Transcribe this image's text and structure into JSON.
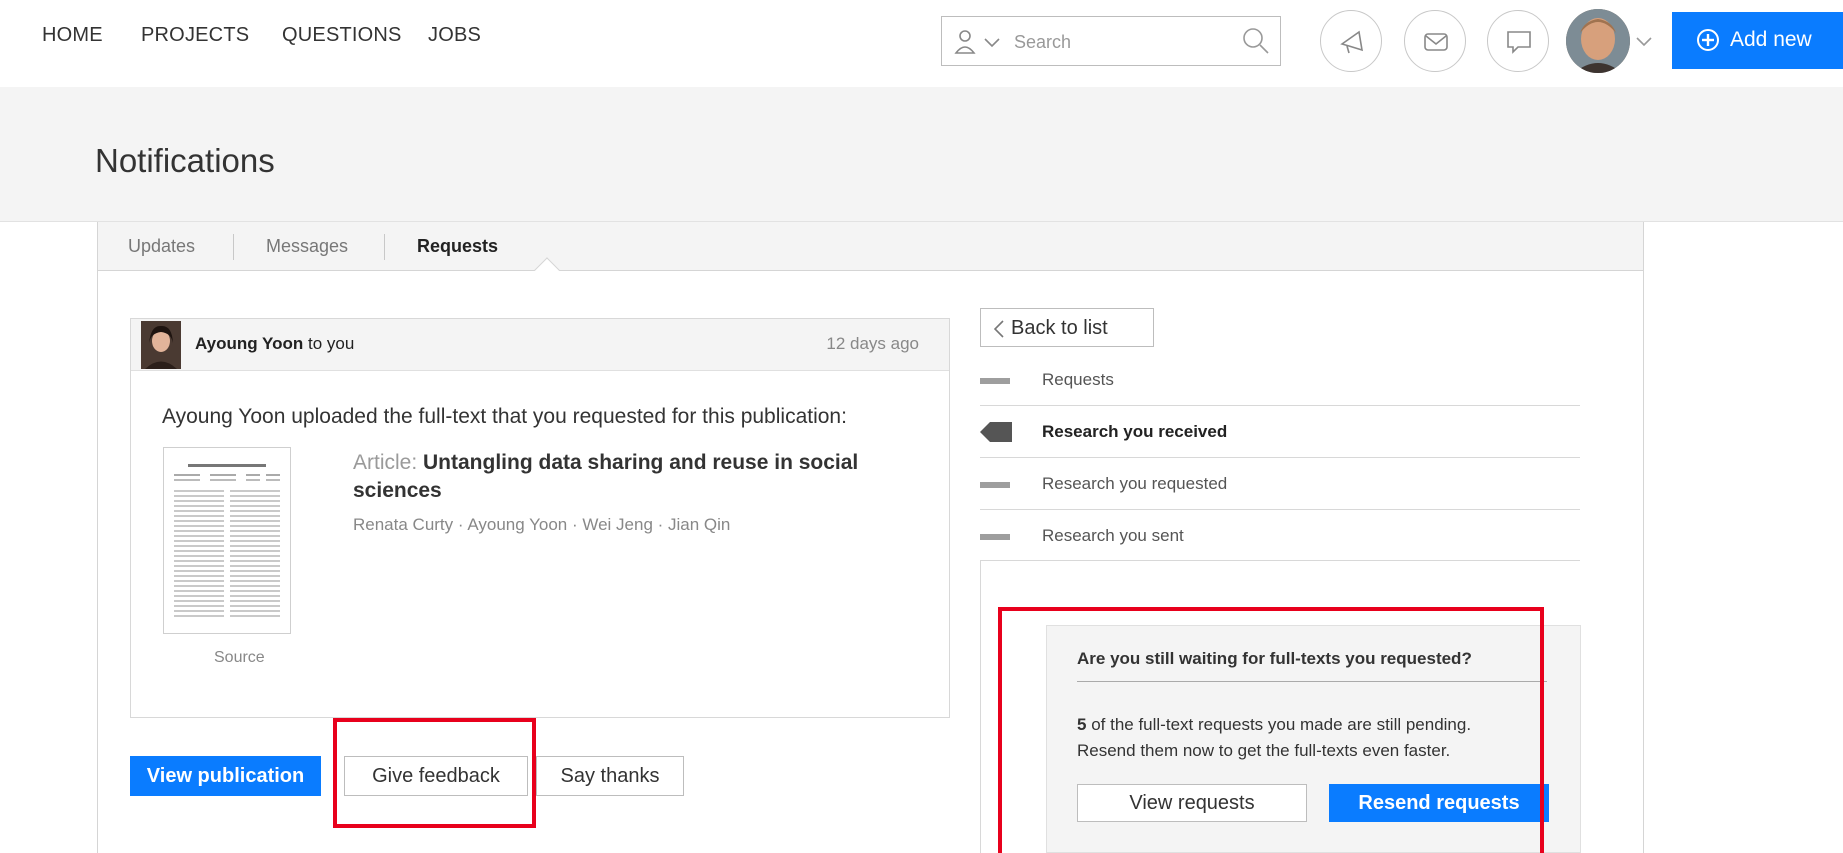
{
  "nav": {
    "links": [
      "HOME",
      "PROJECTS",
      "QUESTIONS",
      "JOBS"
    ],
    "search_placeholder": "Search",
    "add_new_label": "Add new"
  },
  "header": {
    "title": "Notifications"
  },
  "tabs": [
    {
      "label": "Updates",
      "active": false
    },
    {
      "label": "Messages",
      "active": false
    },
    {
      "label": "Requests",
      "active": true
    }
  ],
  "request": {
    "sender": "Ayoung Yoon",
    "to_text": " to you",
    "time": "12 days ago",
    "message": "Ayoung Yoon uploaded the full-text that you requested for this publication:",
    "article_type": "Article: ",
    "article_title": "Untangling data sharing and reuse in social sciences",
    "authors": "Renata Curty · Ayoung Yoon · Wei Jeng · Jian Qin",
    "source_label": "Source",
    "buttons": {
      "view": "View publication",
      "feedback": "Give feedback",
      "thanks": "Say thanks"
    }
  },
  "side": {
    "back_label": "Back to list",
    "items": [
      {
        "label": "Requests",
        "active": false
      },
      {
        "label": "Research you received",
        "active": true
      },
      {
        "label": "Research you requested",
        "active": false
      },
      {
        "label": "Research you sent",
        "active": false
      }
    ],
    "promo": {
      "title": "Are you still waiting for full-texts you requested?",
      "count": "5",
      "text_1": " of the full-text requests you made are still pending.",
      "text_2": "Resend them now to get the full-texts even faster.",
      "view_label": "View requests",
      "resend_label": "Resend requests"
    }
  },
  "colors": {
    "accent": "#0a7cff",
    "highlight": "#e8001c"
  }
}
